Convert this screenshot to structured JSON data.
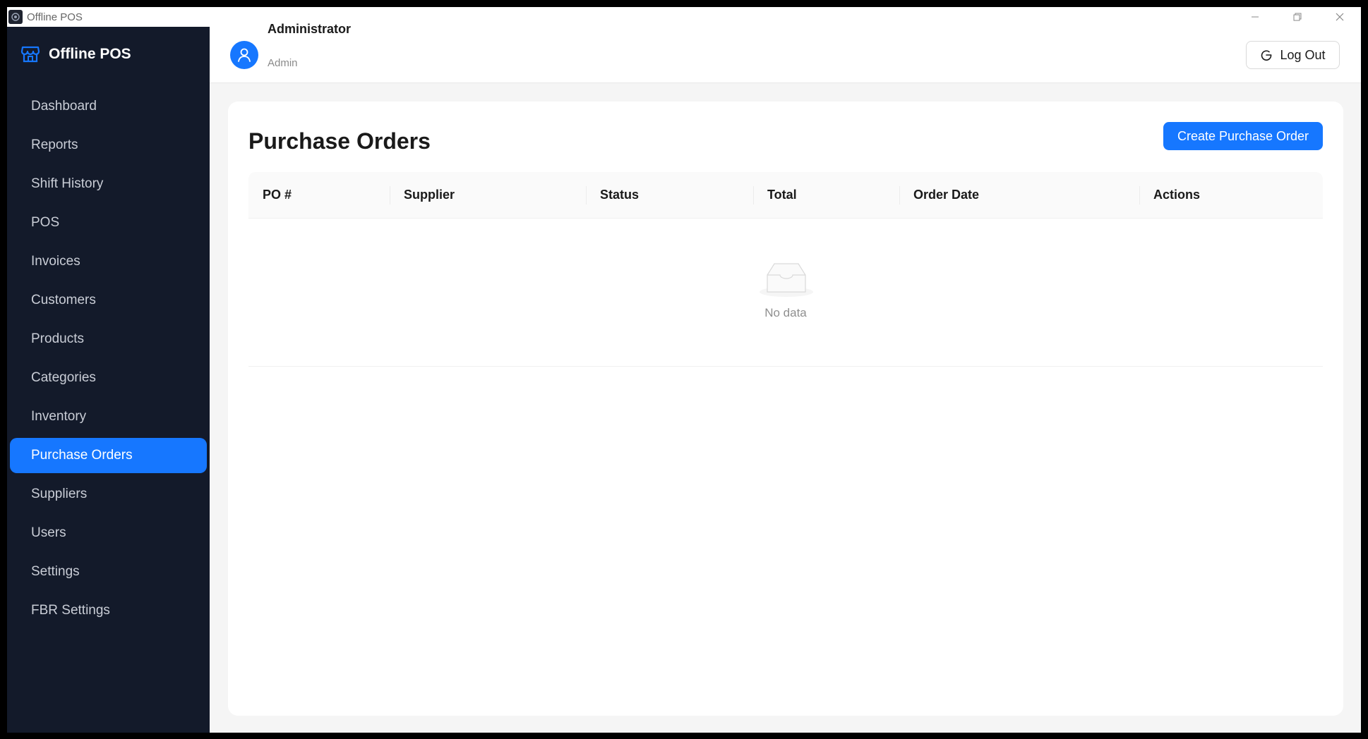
{
  "window": {
    "title": "Offline POS"
  },
  "sidebar": {
    "brand": "Offline POS",
    "items": [
      {
        "label": "Dashboard"
      },
      {
        "label": "Reports"
      },
      {
        "label": "Shift History"
      },
      {
        "label": "POS"
      },
      {
        "label": "Invoices"
      },
      {
        "label": "Customers"
      },
      {
        "label": "Products"
      },
      {
        "label": "Categories"
      },
      {
        "label": "Inventory"
      },
      {
        "label": "Purchase Orders",
        "active": true
      },
      {
        "label": "Suppliers"
      },
      {
        "label": "Users"
      },
      {
        "label": "Settings"
      },
      {
        "label": "FBR Settings"
      }
    ]
  },
  "header": {
    "user_name": "Administrator",
    "user_role": "Admin",
    "logout_label": "Log Out"
  },
  "main": {
    "title": "Purchase Orders",
    "create_label": "Create Purchase Order",
    "table": {
      "columns": [
        "PO #",
        "Supplier",
        "Status",
        "Total",
        "Order Date",
        "Actions"
      ],
      "rows": [],
      "empty_text": "No data"
    }
  },
  "colors": {
    "accent": "#1677ff",
    "sidebar_bg": "#131a2a"
  },
  "icons": {
    "brand": "store-icon",
    "avatar": "user-icon",
    "logout": "logout-icon",
    "empty": "inbox-icon"
  }
}
